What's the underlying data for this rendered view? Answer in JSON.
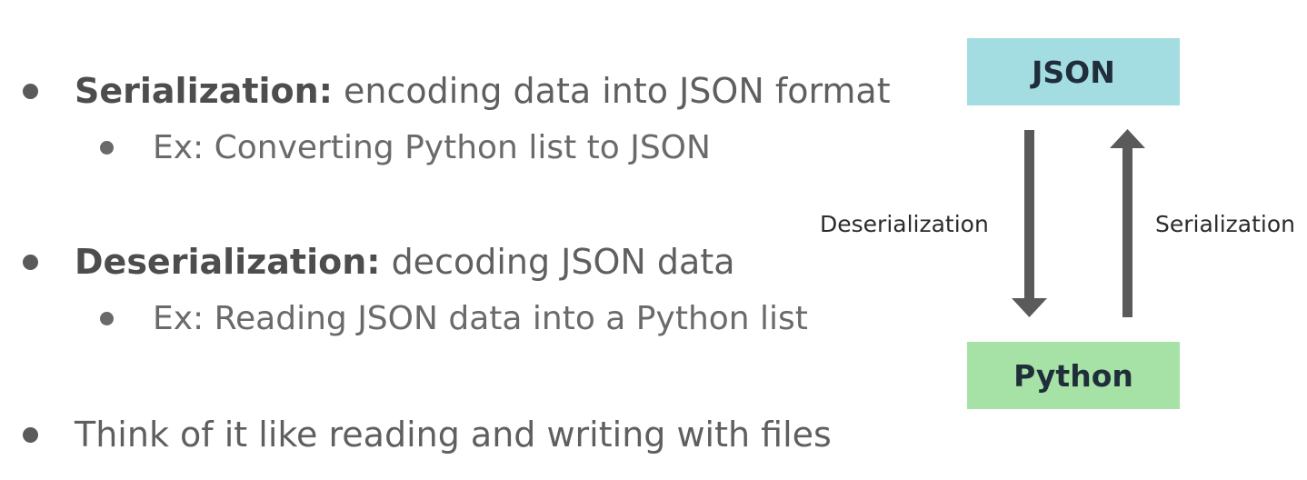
{
  "bullets": [
    {
      "term": "Serialization:",
      "text": " encoding data into JSON format"
    },
    {
      "text": "Ex: Converting Python list to JSON"
    },
    {
      "term": "Deserialization:",
      "text": " decoding JSON data"
    },
    {
      "text": "Ex: Reading JSON data into a Python list"
    },
    {
      "text": "Think of it like reading and writing with files"
    }
  ],
  "diagram": {
    "top_box": "JSON",
    "bottom_box": "Python",
    "down_arrow_label": "Deserialization",
    "up_arrow_label": "Serialization"
  },
  "colors": {
    "json_box": "#a3dde2",
    "python_box": "#a6e2a5",
    "arrow": "#5a5a5a"
  }
}
